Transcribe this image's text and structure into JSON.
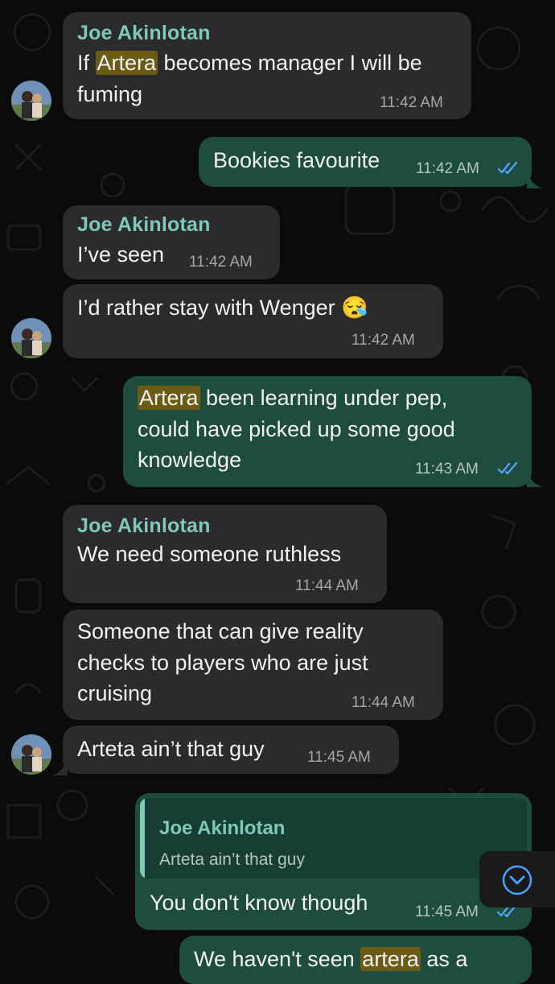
{
  "colors": {
    "background": "#0b0b0b",
    "incoming_bubble": "#2b2b2d",
    "outgoing_bubble": "#1e4d3f",
    "sender_name": "#7ec9b7",
    "highlight": "#6b5b15",
    "read_ticks": "#53a6ff"
  },
  "messages": [
    {
      "sender": "Joe Akinlotan",
      "text_before": "If ",
      "highlight": "Artera",
      "text_after": " becomes manager I will be",
      "line2": "fuming",
      "time": "11:42 AM"
    },
    {
      "text": "Bookies favourite",
      "time": "11:42 AM",
      "status": "read-ticks-icon"
    },
    {
      "sender": "Joe Akinlotan",
      "text": "I’ve seen",
      "time": "11:42 AM"
    },
    {
      "text": "I’d rather stay with Wenger 😪",
      "time": "11:42 AM"
    },
    {
      "highlight": "Artera",
      "text_after": " been learning under pep,",
      "line2": "could have picked up some good",
      "line3": "knowledge",
      "time": "11:43 AM",
      "status": "read-ticks-icon"
    },
    {
      "sender": "Joe Akinlotan",
      "text": "We need someone ruthless",
      "time": "11:44 AM"
    },
    {
      "line1": "Someone that can give reality",
      "line2": "checks to players who are just",
      "line3": "cruising",
      "time": "11:44 AM"
    },
    {
      "text": "Arteta ain’t that guy",
      "time": "11:45 AM"
    },
    {
      "quote_sender": "Joe Akinlotan",
      "quote_text": "Arteta ain’t that guy",
      "text": "You don't know though",
      "time": "11:45 AM",
      "status": "read-ticks-icon"
    },
    {
      "text_before": "We haven't seen ",
      "highlight": "artera",
      "text_after": " as a"
    }
  ],
  "scroll_button": {
    "icon": "chevron-down-circle-icon"
  }
}
